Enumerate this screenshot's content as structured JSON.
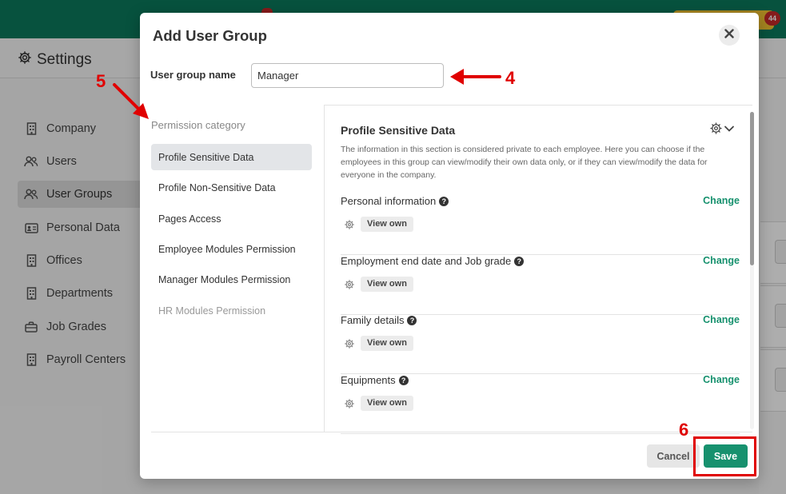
{
  "app": {
    "page_title": "Settings",
    "notification_count": "44"
  },
  "sidebar": {
    "items": [
      {
        "label": "Company",
        "icon": "building-icon"
      },
      {
        "label": "Users",
        "icon": "users-icon"
      },
      {
        "label": "User Groups",
        "icon": "users-icon",
        "active": true
      },
      {
        "label": "Personal Data",
        "icon": "id-card-icon"
      },
      {
        "label": "Offices",
        "icon": "building-icon"
      },
      {
        "label": "Departments",
        "icon": "building-icon"
      },
      {
        "label": "Job Grades",
        "icon": "briefcase-icon"
      },
      {
        "label": "Payroll Centers",
        "icon": "building-icon"
      }
    ]
  },
  "modal": {
    "title": "Add User Group",
    "name_label": "User group name",
    "name_value": "Manager",
    "category_heading": "Permission category",
    "categories": [
      {
        "label": "Profile Sensitive Data",
        "active": true
      },
      {
        "label": "Profile Non-Sensitive Data"
      },
      {
        "label": "Pages Access"
      },
      {
        "label": "Employee Modules Permission"
      },
      {
        "label": "Manager Modules Permission"
      },
      {
        "label": "HR Modules Permission",
        "muted": true
      }
    ],
    "section": {
      "title": "Profile Sensitive Data",
      "description": "The information in this section is considered private to each employee. Here you can choose if the employees in this group can view/modify their own data only, or if they can view/modify the data for everyone in the company."
    },
    "permissions": [
      {
        "name": "Personal information",
        "change_label": "Change",
        "level": "View own"
      },
      {
        "name": "Employment end date and Job grade",
        "change_label": "Change",
        "level": "View own"
      },
      {
        "name": "Family details",
        "change_label": "Change",
        "level": "View own"
      },
      {
        "name": "Equipments",
        "change_label": "Change",
        "level": "View own"
      }
    ],
    "cancel_label": "Cancel",
    "save_label": "Save"
  },
  "annotations": {
    "step_4": "4",
    "step_5": "5",
    "step_6": "6",
    "color": "#e00000"
  },
  "colors": {
    "brand_green": "#0b7a5c",
    "accent_green": "#17916e",
    "badge_red": "#c62828",
    "badge_yellow": "#f2c230"
  }
}
